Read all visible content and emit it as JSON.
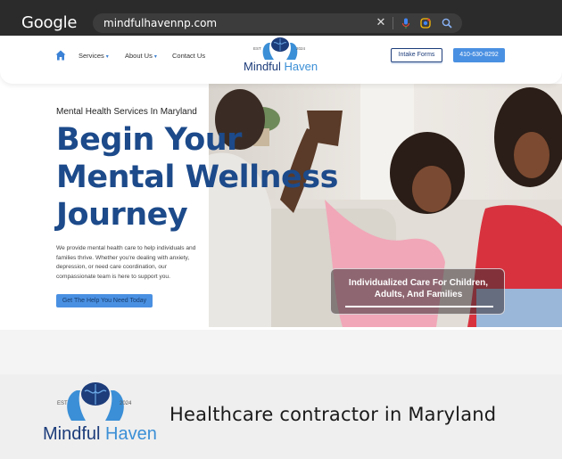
{
  "browser": {
    "logo": "Google",
    "search_query": "mindfulhavennp.com",
    "icons": [
      "close-icon",
      "mic-icon",
      "lens-icon",
      "search-icon"
    ]
  },
  "header": {
    "nav_items": [
      {
        "label": "Services",
        "has_dropdown": true
      },
      {
        "label": "About Us",
        "has_dropdown": true
      },
      {
        "label": "Contact Us",
        "has_dropdown": false
      }
    ],
    "logo": {
      "est": "EST",
      "year": "2024",
      "word_1": "Mindful",
      "word_2": "Haven"
    },
    "intake_label": "Intake Forms",
    "phone_label": "410-630-8292"
  },
  "hero": {
    "eyebrow": "Mental Health Services In Maryland",
    "headline": "Begin Your Mental Wellness Journey",
    "description": "We provide mental health care to help individuals and families thrive. Whether you're dealing with anxiety, depression, or need care coordination, our compassionate team is here to support you.",
    "cta_label": "Get The Help You Need Today",
    "caption": "Individualized Care For Children, Adults, And Families"
  },
  "footer_brand": {
    "logo": {
      "est": "EST",
      "year": "2024",
      "word_1": "Mindful",
      "word_2": "Haven"
    },
    "tagline": "Healthcare contractor in Maryland"
  },
  "colors": {
    "navy": "#1c3c7a",
    "headline_blue": "#1c4a8a",
    "accent_blue": "#4a90e2",
    "logo_light_blue": "#3b8fd6"
  }
}
